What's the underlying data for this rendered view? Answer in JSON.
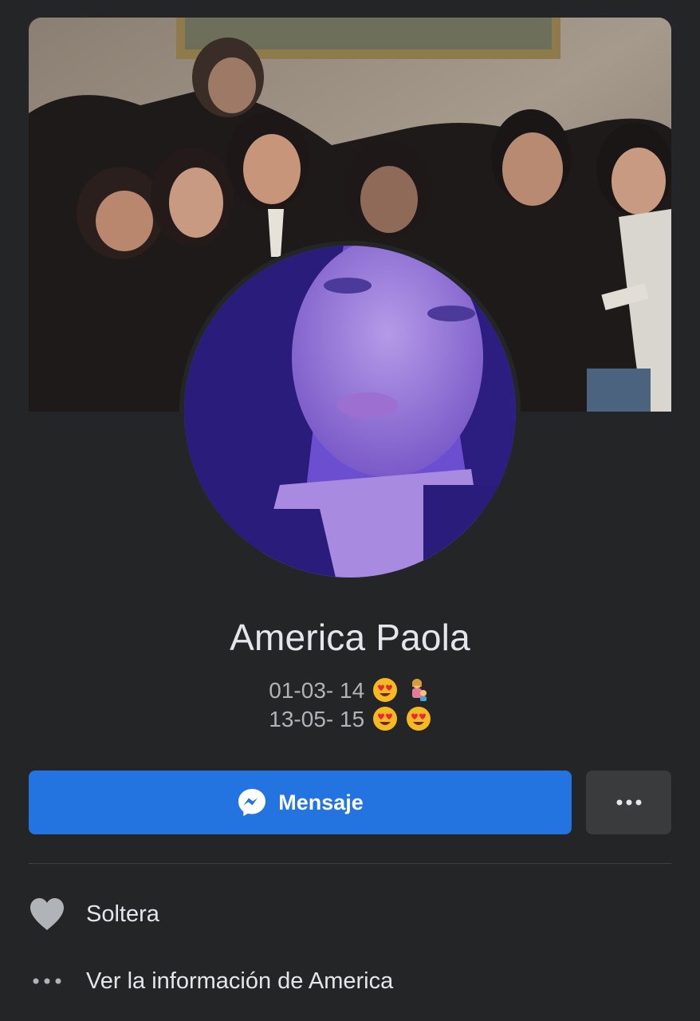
{
  "profile": {
    "name": "America Paola",
    "bio_line1": "01-03- 14",
    "bio_line2": "13-05- 15",
    "bio_line1_emojis": [
      "heart-eyes-emoji",
      "woman-with-child-emoji"
    ],
    "bio_line2_emojis": [
      "heart-eyes-emoji",
      "heart-eyes-emoji"
    ]
  },
  "actions": {
    "message_label": "Mensaje",
    "message_icon": "messenger-icon",
    "more_icon": "more-dots-icon"
  },
  "details": {
    "relationship": "Soltera",
    "relationship_icon": "heart-icon",
    "see_info": "Ver la información de America",
    "see_info_icon": "more-dots-icon"
  },
  "colors": {
    "background": "#242527",
    "primary_button": "#2374e1",
    "secondary_button": "#3a3b3c",
    "primary_text": "#e4e6eb",
    "secondary_text": "#b0b3b8"
  }
}
